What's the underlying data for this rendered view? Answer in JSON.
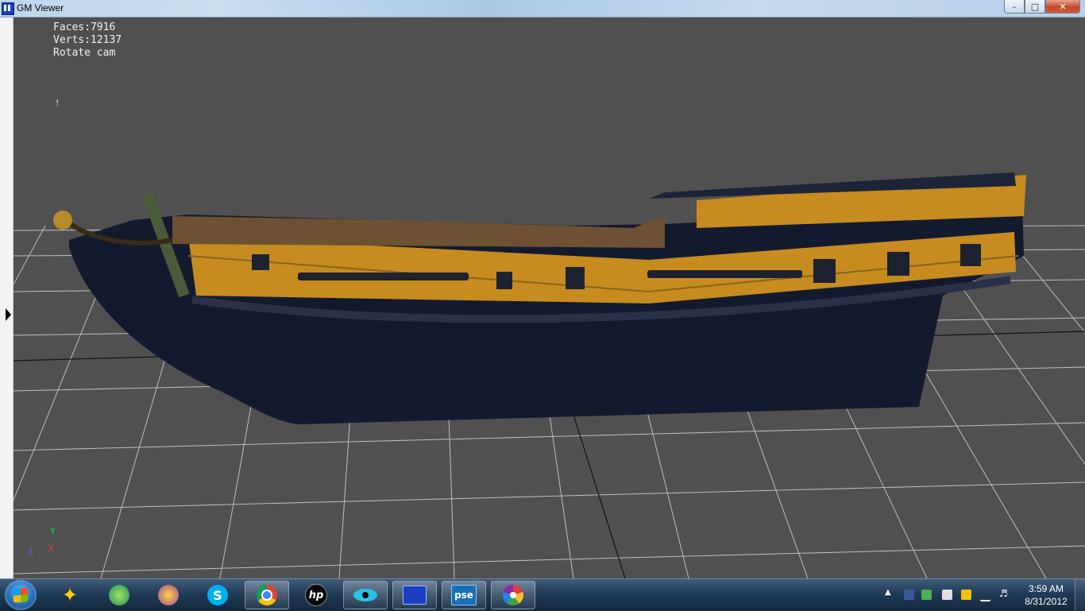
{
  "window": {
    "title": "GM Viewer",
    "buttons": {
      "minimize": "–",
      "maximize": "□",
      "close": "✕"
    }
  },
  "viewport": {
    "stats": {
      "faces": "Faces:7916",
      "verts": "Verts:12137",
      "mode": "Rotate cam"
    },
    "marker": "!",
    "axes": {
      "y": "Y",
      "z": "Z",
      "x": "X"
    },
    "colors": {
      "background": "#505050",
      "grid": "#d8d8d8",
      "hull": "#141a2e",
      "wale": "#c28a1e"
    }
  },
  "taskbar": {
    "items": [
      {
        "name": "aim",
        "icon": "running-man-icon"
      },
      {
        "name": "live-messenger",
        "icon": "messenger-icon"
      },
      {
        "name": "yahoo-messenger",
        "icon": "yahoo-icon"
      },
      {
        "name": "skype",
        "icon": "skype-icon"
      },
      {
        "name": "chrome",
        "icon": "chrome-icon"
      },
      {
        "name": "hp",
        "icon": "hp-icon",
        "label": "hp"
      },
      {
        "name": "eye-app",
        "icon": "eye-icon"
      },
      {
        "name": "gm-viewer",
        "icon": "gm-viewer-icon"
      },
      {
        "name": "photoshop-elements",
        "icon": "pse-icon",
        "label": "pse"
      },
      {
        "name": "picasa",
        "icon": "picasa-icon"
      }
    ],
    "clock": {
      "time": "3:59 AM",
      "date": "8/31/2012"
    },
    "tray_arrow": "▲"
  }
}
